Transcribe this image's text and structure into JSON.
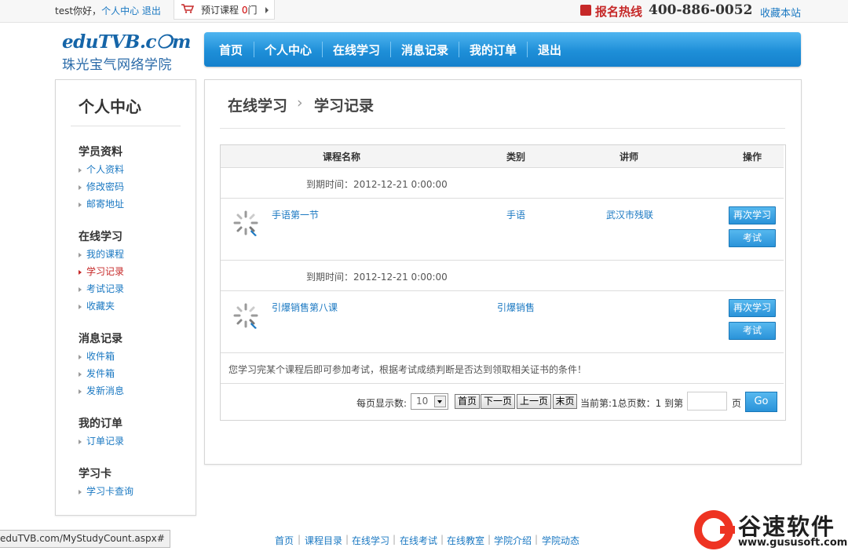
{
  "topbar": {
    "user": "test",
    "greeting_suffix": "你好，",
    "personal_center": "个人中心",
    "logout": "退出",
    "cart_label": "预订课程",
    "cart_count": "0",
    "cart_unit": "门",
    "hotline_label": "报名热线",
    "hotline_number": "400-886-0052",
    "favorite": "收藏本站"
  },
  "logo": {
    "line1": "eduTVB.c❍m",
    "line2": "珠光宝气网络学院"
  },
  "nav": [
    "首页",
    "个人中心",
    "在线学习",
    "消息记录",
    "我的订单",
    "退出"
  ],
  "sidebar": {
    "title": "个人中心",
    "groups": [
      {
        "title": "学员资料",
        "items": [
          "个人资料",
          "修改密码",
          "邮寄地址"
        ]
      },
      {
        "title": "在线学习",
        "items": [
          "我的课程",
          "学习记录",
          "考试记录",
          "收藏夹"
        ]
      },
      {
        "title": "消息记录",
        "items": [
          "收件箱",
          "发件箱",
          "发新消息"
        ]
      },
      {
        "title": "我的订单",
        "items": [
          "订单记录"
        ]
      },
      {
        "title": "学习卡",
        "items": [
          "学习卡查询"
        ]
      }
    ]
  },
  "breadcrumb": {
    "parent": "在线学习",
    "sep": "›",
    "current": "学习记录"
  },
  "table": {
    "headers": [
      "课程名称",
      "类别",
      "讲师",
      "操作"
    ],
    "rows": [
      {
        "expire": "到期时间：2012-12-21 0:00:00",
        "course": "手语第一节",
        "category": "手语",
        "teacher": "武汉市残联"
      },
      {
        "expire": "到期时间：2012-12-21 0:00:00",
        "course": "引爆销售第八课",
        "category": "引爆销售",
        "teacher": ""
      }
    ],
    "btn_restudy": "再次学习",
    "btn_exam": "考试",
    "note": "您学习完某个课程后即可参加考试，根据考试成绩判断是否达到领取相关证书的条件！"
  },
  "pager": {
    "per_page_label": "每页显示数:",
    "per_page_value": "10",
    "first": "首页",
    "next": "下一页",
    "prev": "上一页",
    "last": "末页",
    "info": "当前第:1总页数：1 到第",
    "page_unit": "页",
    "go": "Go"
  },
  "footer": {
    "links": [
      "首页",
      "课程目录",
      "在线学习",
      "在线考试",
      "在线教室",
      "学院介绍",
      "学院动态"
    ]
  },
  "status_url": "eduTVB.com/MyStudyCount.aspx#",
  "watermark": {
    "name": "谷速软件",
    "url": "www.gususoft.com"
  },
  "colors": {
    "accent": "#1e8fd8",
    "link": "#1a78c2",
    "active": "#c62828"
  }
}
